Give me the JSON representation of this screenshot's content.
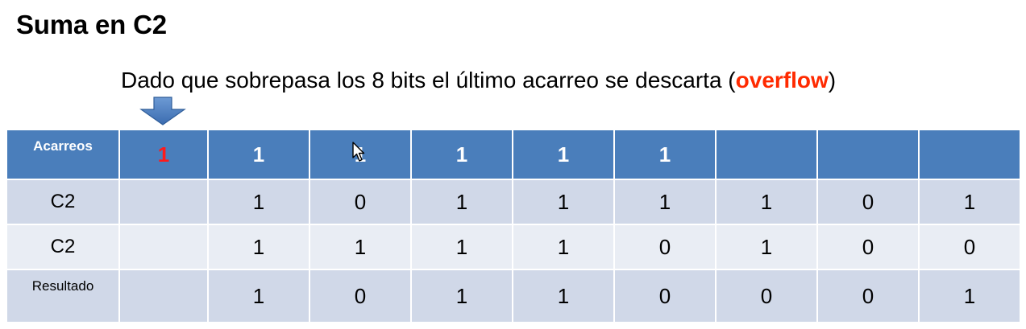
{
  "title": "Suma en C2",
  "note": {
    "prefix": "Dado que sobrepasa los 8 bits el último acarreo se descarta (",
    "highlight": "overflow",
    "suffix": ")",
    "highlight_color": "#ff2a00"
  },
  "colors": {
    "header_bg": "#4a7ebb",
    "row_dark": "#d0d8e8",
    "row_light": "#e9edf4",
    "overflow_bit": "#ff1a1a"
  },
  "table": {
    "carries": {
      "label": "Acarreos",
      "overflow": "1",
      "bits": [
        "1",
        "1",
        "1",
        "1",
        "1",
        "",
        "",
        ""
      ]
    },
    "operand_a": {
      "label": "C2",
      "extra": "",
      "bits": [
        "1",
        "0",
        "1",
        "1",
        "1",
        "1",
        "0",
        "1"
      ]
    },
    "operand_b": {
      "label": "C2",
      "extra": "",
      "bits": [
        "1",
        "1",
        "1",
        "1",
        "0",
        "1",
        "0",
        "0"
      ]
    },
    "result": {
      "label": "Resultado",
      "extra": "",
      "bits": [
        "1",
        "0",
        "1",
        "1",
        "0",
        "0",
        "0",
        "1"
      ]
    }
  }
}
